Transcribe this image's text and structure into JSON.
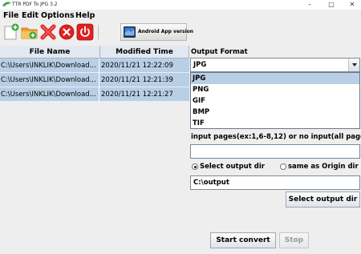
{
  "window": {
    "title": "TTR PDF To JPG 3.2",
    "controls": {
      "minimize": "–",
      "maximize": "□",
      "close": "✕"
    }
  },
  "menu": {
    "items": [
      "File",
      "Edit",
      "Options",
      "Help"
    ]
  },
  "toolbar": {
    "icons": [
      "add-file-icon",
      "add-folder-icon",
      "remove-icon",
      "clear-icon",
      "power-icon"
    ],
    "android_button": "Android App version"
  },
  "table": {
    "columns": [
      "File Name",
      "Modified Time"
    ],
    "rows": [
      {
        "name": "C:\\Users\\INKLIK\\Download...",
        "time": "2020/11/21 12:22:09"
      },
      {
        "name": "C:\\Users\\INKLIK\\Download...",
        "time": "2020/11/21 12:21:39"
      },
      {
        "name": "C:\\Users\\INKLIK\\Download...",
        "time": "2020/11/21 12:21:27"
      }
    ]
  },
  "output": {
    "format_label": "Output Format",
    "selected_format": "JPG",
    "options": [
      "JPG",
      "PNG",
      "GIF",
      "BMP",
      "TIF"
    ],
    "pages_label": "input pages(ex:1,6-8,12) or no input(all pages)",
    "pages_value": "",
    "radio_select_dir": "Select output dir",
    "radio_same_origin": "same as Origin dir",
    "radio_selected": "Select output dir",
    "dir_value": "C:\\output",
    "select_dir_button": "Select output dir"
  },
  "actions": {
    "start": "Start convert",
    "stop": "Stop"
  },
  "colors": {
    "selection": "#b8cfe5",
    "background": "#eeeeee",
    "header": "#e3e8f0"
  }
}
